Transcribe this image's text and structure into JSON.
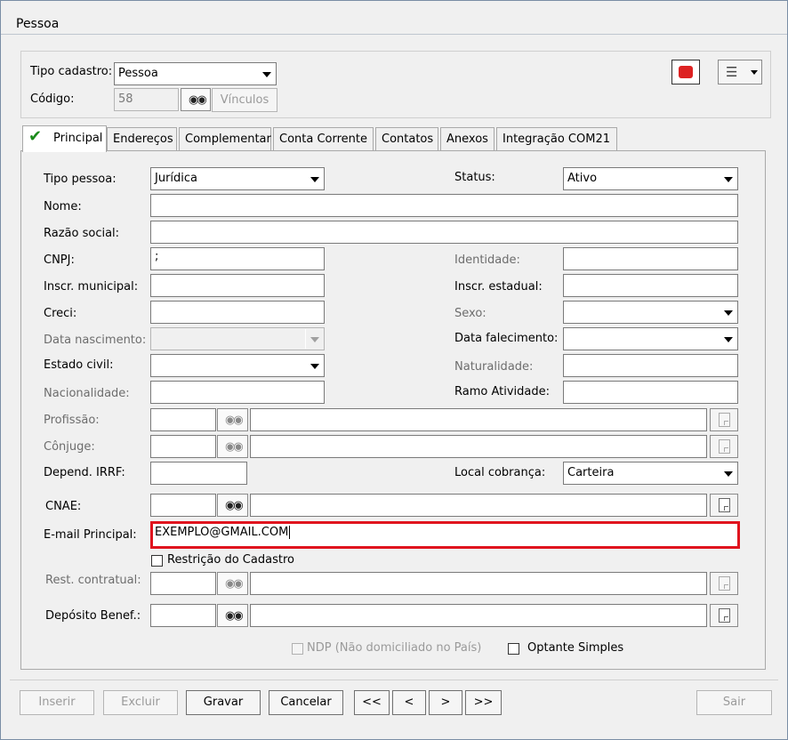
{
  "window": {
    "title": "Pessoa"
  },
  "header": {
    "tipo_cadastro_label": "Tipo cadastro:",
    "tipo_cadastro_value": "Pessoa",
    "codigo_label": "Código:",
    "codigo_value": "58",
    "vinculos_label": "Vínculos"
  },
  "tabs": [
    {
      "label": "Principal",
      "active": true
    },
    {
      "label": "Endereços"
    },
    {
      "label": "Complementar"
    },
    {
      "label": "Conta Corrente"
    },
    {
      "label": "Contatos"
    },
    {
      "label": "Anexos"
    },
    {
      "label": "Integração COM21"
    }
  ],
  "form": {
    "tipo_pessoa_label": "Tipo pessoa:",
    "tipo_pessoa_value": "Jurídica",
    "status_label": "Status:",
    "status_value": "Ativo",
    "nome_label": "Nome:",
    "nome_value": "",
    "razao_label": "Razão social:",
    "razao_value": "",
    "cnpj_label": "CNPJ:",
    "cnpj_value": ";",
    "identidade_label": "Identidade:",
    "inscr_mun_label": "Inscr. municipal:",
    "inscr_est_label": "Inscr. estadual:",
    "creci_label": "Creci:",
    "sexo_label": "Sexo:",
    "data_nasc_label": "Data nascimento:",
    "data_fal_label": "Data falecimento:",
    "estado_civil_label": "Estado civil:",
    "naturalidade_label": "Naturalidade:",
    "nacionalidade_label": "Nacionalidade:",
    "ramo_label": "Ramo Atividade:",
    "profissao_label": "Profissão:",
    "conjuge_label": "Cônjuge:",
    "depend_label": "Depend. IRRF:",
    "local_cob_label": "Local cobrança:",
    "local_cob_value": "Carteira",
    "cnae_label": "CNAE:",
    "email_label": "E-mail Principal:",
    "email_value": "EXEMPLO@GMAIL.COM",
    "restricao_label": "Restrição do Cadastro",
    "rest_contratual_label": "Rest. contratual:",
    "deposito_label": "Depósito Benef.:",
    "ndp_label": "NDP (Não domiciliado no País)",
    "optante_label": "Optante Simples"
  },
  "footer": {
    "inserir": "Inserir",
    "excluir": "Excluir",
    "gravar": "Gravar",
    "cancelar": "Cancelar",
    "first": "<<",
    "prev": "<",
    "next": ">",
    "last": ">>",
    "sair": "Sair"
  },
  "colors": {
    "highlight": "#e0141e",
    "check": "#1a8a1a"
  }
}
